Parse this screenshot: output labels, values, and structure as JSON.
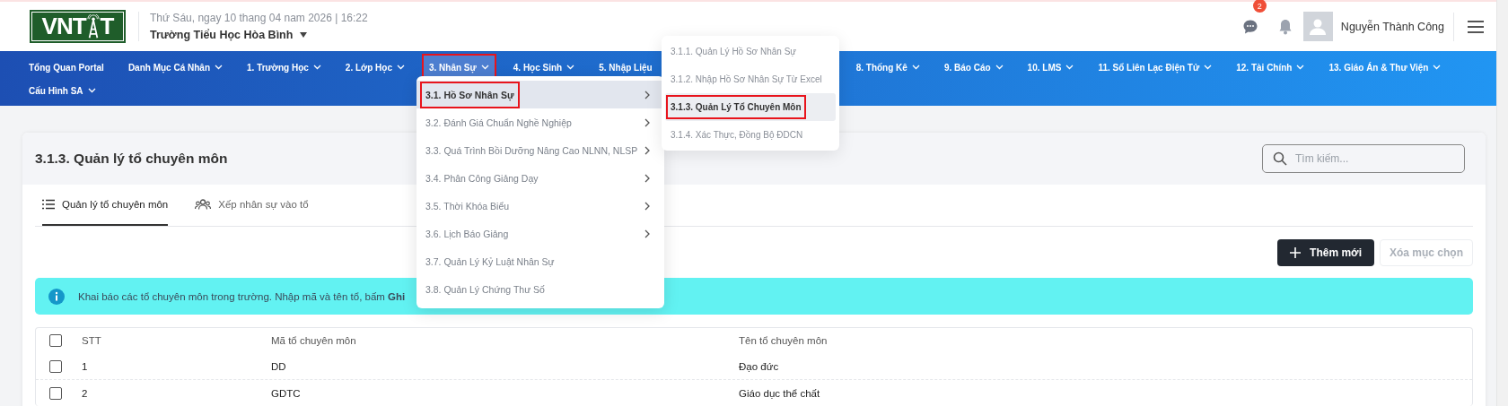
{
  "header": {
    "logo": {
      "left": "VNT",
      "right": "T"
    },
    "date": "Thứ Sáu, ngay 10 thang 04 nam 2026 | 16:22",
    "school": "Trường Tiểu Học Hòa Bình",
    "messages_badge": "2",
    "user_name": "Nguyễn Thành Công"
  },
  "nav": [
    {
      "label": "Tổng Quan Portal",
      "has_menu": false,
      "selected": false
    },
    {
      "label": "Danh Mục Cá Nhân",
      "has_menu": true,
      "selected": false
    },
    {
      "label": "1. Trường Học",
      "has_menu": true,
      "selected": false
    },
    {
      "label": "2. Lớp Học",
      "has_menu": true,
      "selected": false
    },
    {
      "label": "3. Nhân Sự",
      "has_menu": true,
      "selected": true
    },
    {
      "label": "4. Học Sinh",
      "has_menu": true,
      "selected": false
    },
    {
      "label": "5. Nhập Liệu",
      "selected": false
    },
    {
      "label": "8. Thống Kê",
      "has_menu": true,
      "selected": false
    },
    {
      "label": "9. Báo Cáo",
      "has_menu": true,
      "selected": false
    },
    {
      "label": "10. LMS",
      "has_menu": true,
      "selected": false
    },
    {
      "label": "11. Sổ Liên Lạc Điện Tử",
      "has_menu": true,
      "selected": false
    },
    {
      "label": "12. Tài Chính",
      "has_menu": true,
      "selected": false
    },
    {
      "label": "13. Giáo Án & Thư Viện",
      "has_menu": true,
      "selected": false
    },
    {
      "label": "Cấu Hình SA",
      "has_menu": true,
      "selected": false
    }
  ],
  "menu": [
    {
      "label": "3.1. Hồ Sơ Nhân Sự",
      "has_submenu": true,
      "selected": true
    },
    {
      "label": "3.2. Đánh Giá Chuẩn Nghề Nghiệp",
      "has_submenu": true,
      "selected": false
    },
    {
      "label": "3.3. Quá Trình Bồi Dưỡng Nâng Cao NLNN, NLSP",
      "has_submenu": true,
      "selected": false
    },
    {
      "label": "3.4. Phân Công Giảng Dạy",
      "has_submenu": true,
      "selected": false
    },
    {
      "label": "3.5. Thời Khóa Biểu",
      "has_submenu": true,
      "selected": false
    },
    {
      "label": "3.6. Lịch Báo Giảng",
      "has_submenu": true,
      "selected": false
    },
    {
      "label": "3.7. Quản Lý Kỷ Luật Nhân Sự",
      "has_submenu": false,
      "selected": false
    },
    {
      "label": "3.8. Quản Lý Chứng Thư Số",
      "has_submenu": false,
      "selected": false
    }
  ],
  "submenu": [
    {
      "label": "3.1.1. Quản Lý Hồ Sơ Nhân Sự",
      "selected": false
    },
    {
      "label": "3.1.2. Nhập Hồ Sơ Nhân Sự Từ Excel",
      "selected": false
    },
    {
      "label": "3.1.3. Quản Lý Tổ Chuyên Môn",
      "selected": true
    },
    {
      "label": "3.1.4. Xác Thực, Đồng Bộ ĐDCN",
      "selected": false
    }
  ],
  "page": {
    "title": "3.1.3. Quản lý tổ chuyên môn",
    "search": {
      "placeholder": "Tìm kiếm..."
    },
    "tabs": [
      {
        "label": "Quản lý tổ chuyên môn",
        "selected": true
      },
      {
        "label": "Xếp nhân sự vào tổ",
        "selected": false
      }
    ],
    "buttons": [
      {
        "label": "Thêm mới",
        "kind": "primary",
        "disabled": false
      },
      {
        "label": "Xóa mục chọn",
        "kind": "secondary",
        "disabled": true
      }
    ],
    "info": "Khai báo các tổ chuyên môn trong trường. Nhập mã và tên tổ, bấm **Ghi**"
  },
  "table": {
    "select_all_checked": false,
    "columns": [
      "STT",
      "Mã tổ chuyên môn",
      "Tên tổ chuyên môn"
    ],
    "rows": [
      {
        "cells": [
          "1",
          "DD",
          "Đạo đức"
        ],
        "checked": false
      },
      {
        "cells": [
          "2",
          "GDTC",
          "Giáo dục thể chất"
        ],
        "checked": false
      }
    ]
  }
}
